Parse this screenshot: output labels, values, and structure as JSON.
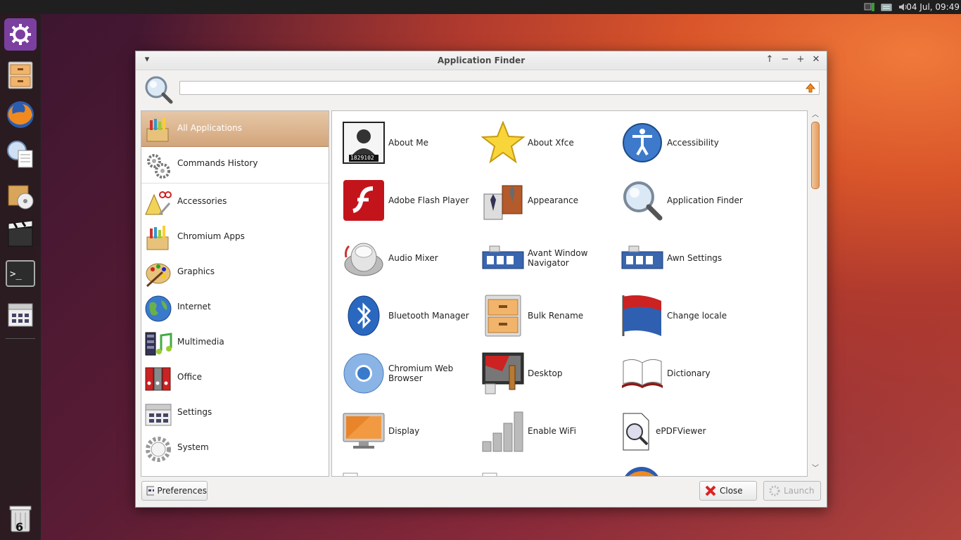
{
  "panel": {
    "clock": "04 Jul, 09:49"
  },
  "dock": {
    "items": [
      "settings-manager-icon",
      "file-manager-icon",
      "firefox-icon",
      "document-viewer-icon",
      "archive-manager-icon",
      "video-player-icon",
      "terminal-icon",
      "settings-icon"
    ],
    "trash_count": "6"
  },
  "window": {
    "title": "Application Finder",
    "search": {
      "value": "",
      "placeholder": ""
    },
    "categories": [
      {
        "label": "All Applications",
        "icon": "all-apps-icon",
        "selected": true
      },
      {
        "label": "Commands History",
        "icon": "gears-icon"
      },
      {
        "label": "Accessories",
        "icon": "accessories-icon"
      },
      {
        "label": "Chromium Apps",
        "icon": "chromium-apps-icon"
      },
      {
        "label": "Graphics",
        "icon": "palette-icon"
      },
      {
        "label": "Internet",
        "icon": "globe-icon"
      },
      {
        "label": "Multimedia",
        "icon": "music-icon"
      },
      {
        "label": "Office",
        "icon": "binders-icon"
      },
      {
        "label": "Settings",
        "icon": "settings-icon"
      },
      {
        "label": "System",
        "icon": "system-gear-icon"
      }
    ],
    "apps": [
      {
        "label": "About Me",
        "icon": "user-card-icon"
      },
      {
        "label": "About Xfce",
        "icon": "star-icon"
      },
      {
        "label": "Accessibility",
        "icon": "accessibility-icon"
      },
      {
        "label": "Adobe Flash Player",
        "icon": "flash-icon"
      },
      {
        "label": "Appearance",
        "icon": "appearance-icon"
      },
      {
        "label": "Application Finder",
        "icon": "magnifier-icon"
      },
      {
        "label": "Audio Mixer",
        "icon": "mixer-knob-icon"
      },
      {
        "label": "Avant Window Navigator",
        "icon": "awn-icon"
      },
      {
        "label": "Awn Settings",
        "icon": "awn-settings-icon"
      },
      {
        "label": "Bluetooth Manager",
        "icon": "bluetooth-icon"
      },
      {
        "label": "Bulk Rename",
        "icon": "cabinet-icon"
      },
      {
        "label": "Change locale",
        "icon": "flag-icon"
      },
      {
        "label": "Chromium Web Browser",
        "icon": "chromium-icon"
      },
      {
        "label": "Desktop",
        "icon": "desktop-paint-icon"
      },
      {
        "label": "Dictionary",
        "icon": "book-icon"
      },
      {
        "label": "Display",
        "icon": "monitor-icon"
      },
      {
        "label": "Enable WiFi",
        "icon": "signal-bars-icon"
      },
      {
        "label": "ePDFViewer",
        "icon": "pdf-viewer-icon"
      }
    ],
    "about_me_badge": "1829102",
    "buttons": {
      "preferences": "Preferences",
      "close": "Close",
      "launch": "Launch"
    }
  },
  "colors": {
    "selection": "#d9ad85",
    "accent": "#e49b5d"
  }
}
